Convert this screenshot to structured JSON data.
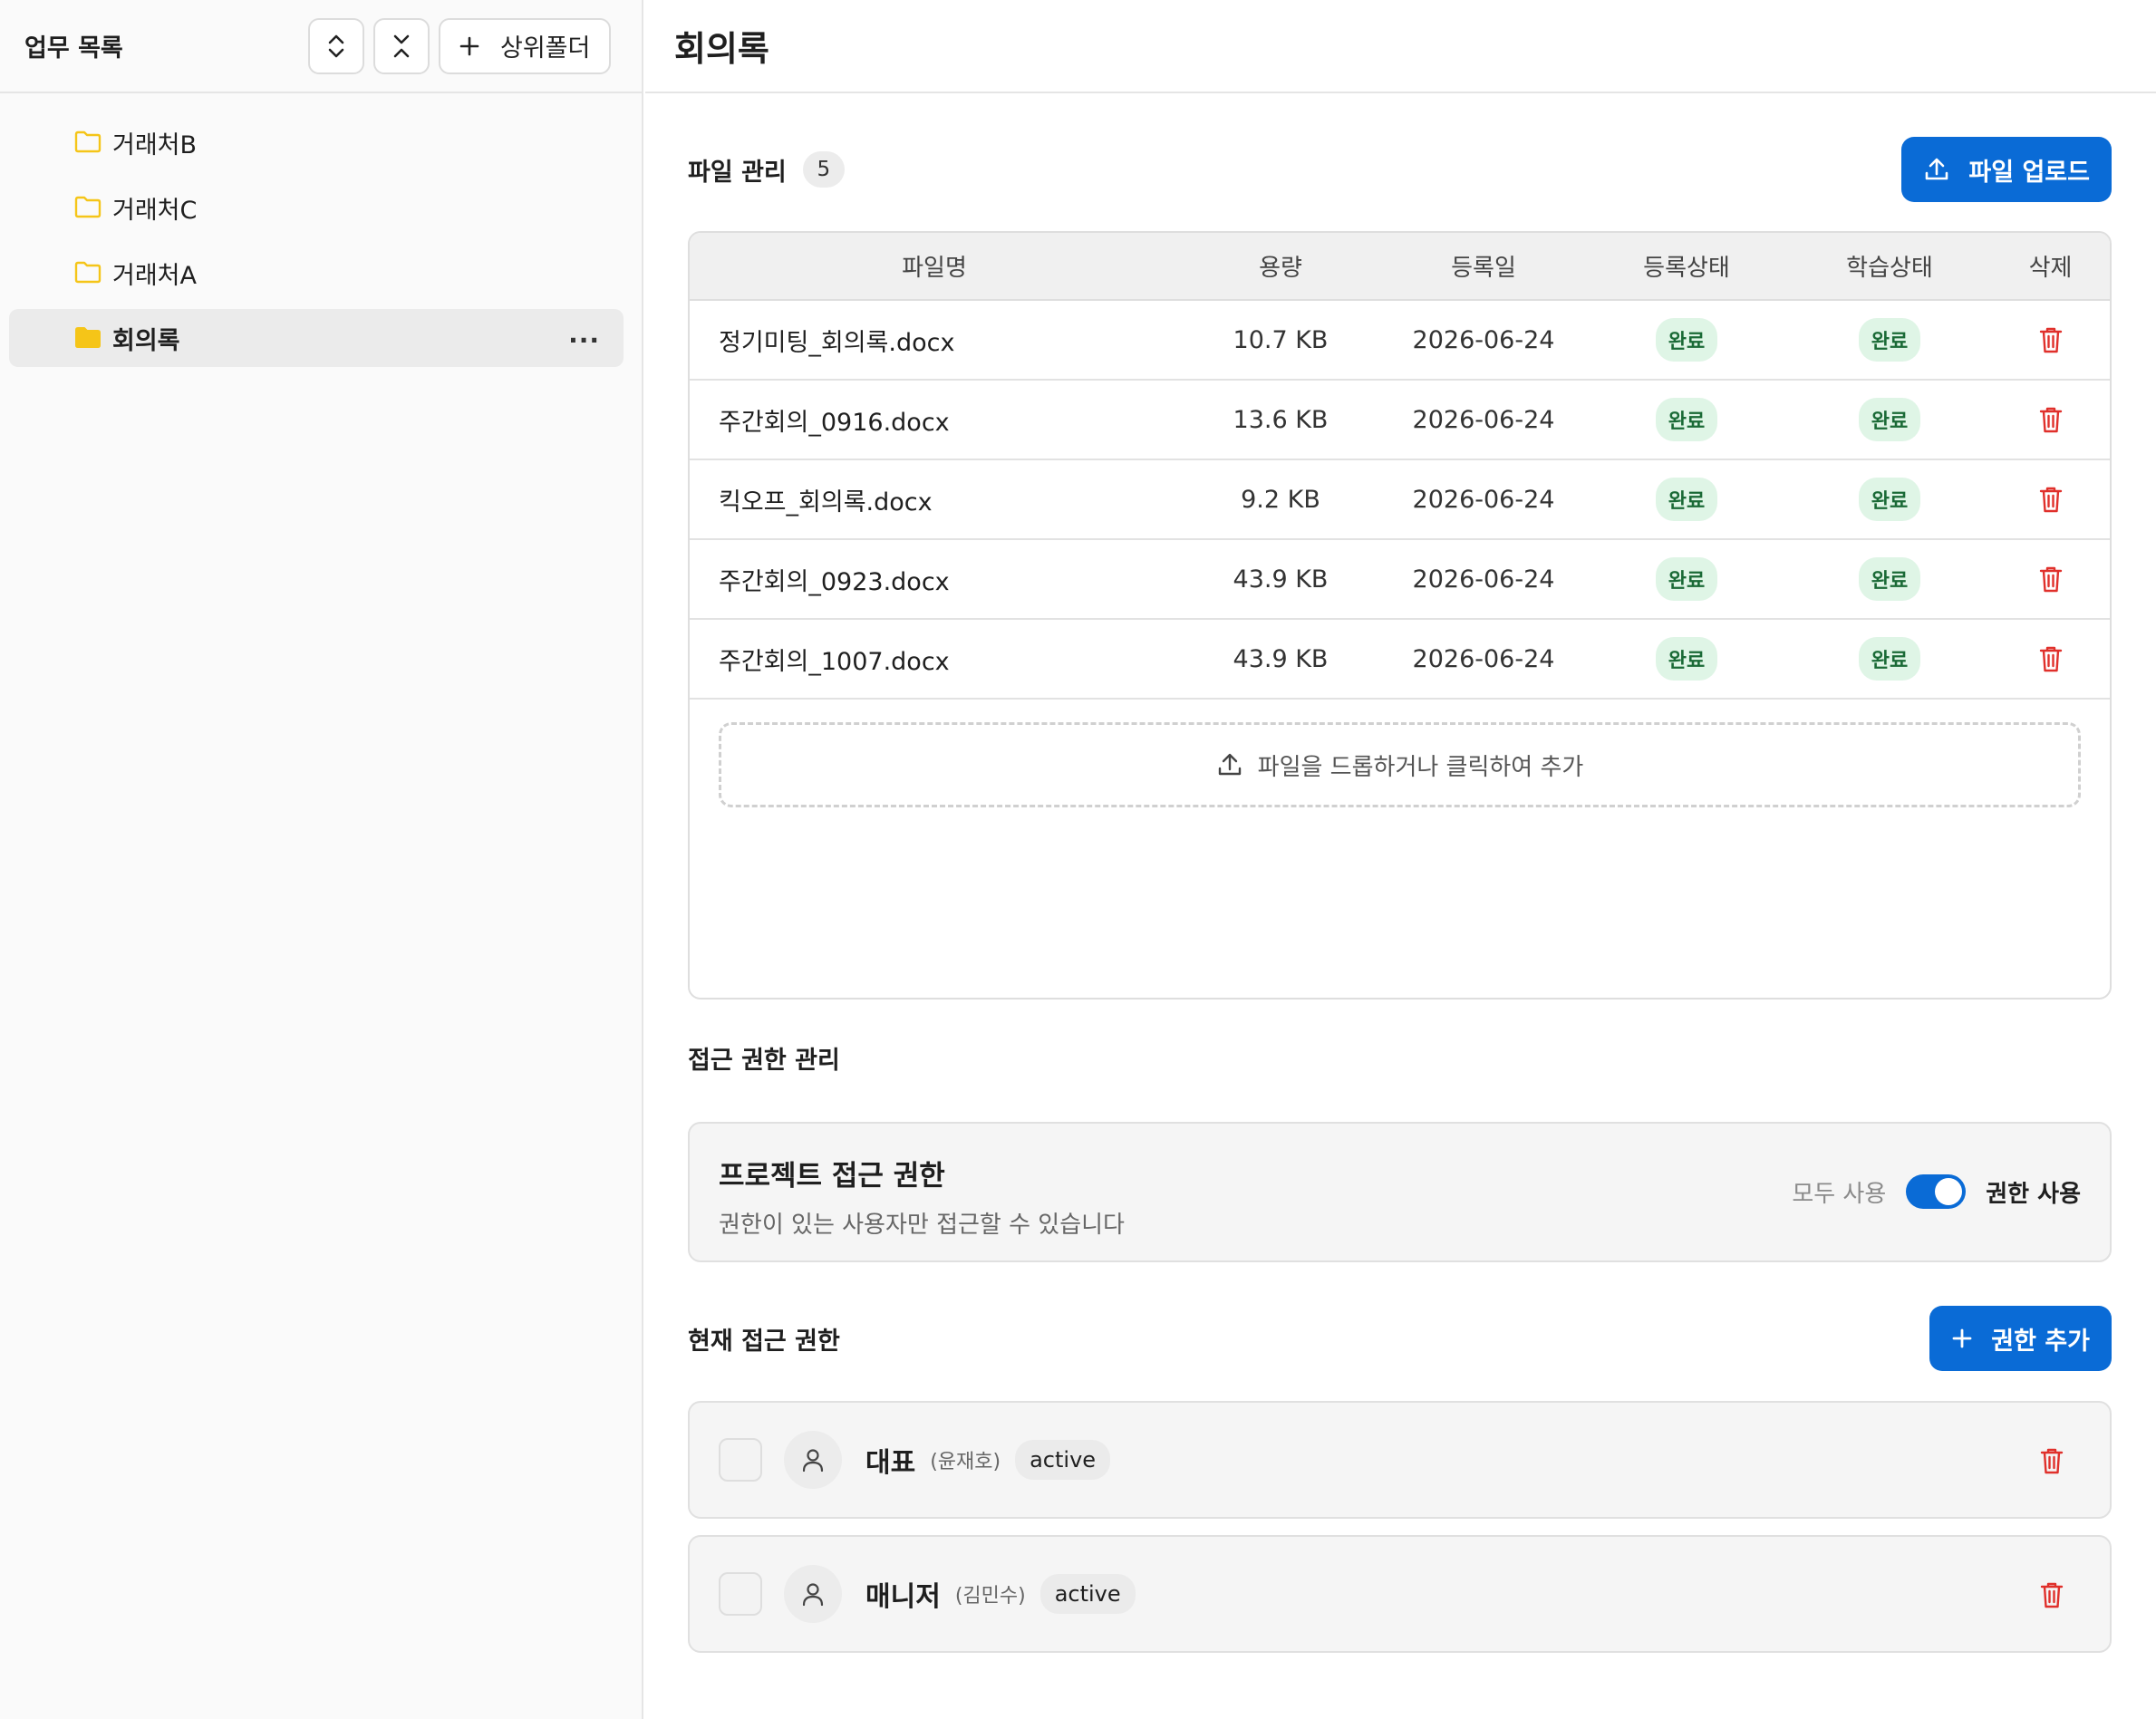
{
  "sidebar": {
    "title": "업무 목록",
    "add_folder_label": "상위폴더",
    "items": [
      {
        "label": "거래처B",
        "active": false
      },
      {
        "label": "거래처C",
        "active": false
      },
      {
        "label": "거래처A",
        "active": false
      },
      {
        "label": "회의록",
        "active": true
      }
    ],
    "more_label": "···"
  },
  "main": {
    "title": "회의록",
    "files": {
      "title": "파일 관리",
      "count": "5",
      "upload_label": "파일 업로드",
      "columns": [
        "파일명",
        "용량",
        "등록일",
        "등록상태",
        "학습상태",
        "삭제"
      ],
      "rows": [
        {
          "name": "정기미팅_회의록.docx",
          "size": "10.7 KB",
          "date": "2026-06-24",
          "reg_status": "완료",
          "learn_status": "완료"
        },
        {
          "name": "주간회의_0916.docx",
          "size": "13.6 KB",
          "date": "2026-06-24",
          "reg_status": "완료",
          "learn_status": "완료"
        },
        {
          "name": "킥오프_회의록.docx",
          "size": "9.2 KB",
          "date": "2026-06-24",
          "reg_status": "완료",
          "learn_status": "완료"
        },
        {
          "name": "주간회의_0923.docx",
          "size": "43.9 KB",
          "date": "2026-06-24",
          "reg_status": "완료",
          "learn_status": "완료"
        },
        {
          "name": "주간회의_1007.docx",
          "size": "43.9 KB",
          "date": "2026-06-24",
          "reg_status": "완료",
          "learn_status": "완료"
        }
      ],
      "dropzone_label": "파일을 드롭하거나 클릭하여 추가"
    },
    "access": {
      "title": "접근 권한 관리",
      "project_title": "프로젝트 접근 권한",
      "project_sub": "권한이 있는 사용자만 접근할 수 있습니다",
      "toggle_off_label": "모두 사용",
      "toggle_on_label": "권한 사용",
      "toggle_on": true
    },
    "current": {
      "title": "현재 접근 권한",
      "add_label": "권한 추가",
      "users": [
        {
          "role": "대표",
          "person": "(윤재호)",
          "status": "active"
        },
        {
          "role": "매니저",
          "person": "(김민수)",
          "status": "active"
        }
      ]
    }
  },
  "colors": {
    "accent": "#0a6bd6",
    "danger": "#e0302b",
    "folder": "#f5c518",
    "success_bg": "#dff5e6",
    "success_text": "#1a6a36"
  }
}
